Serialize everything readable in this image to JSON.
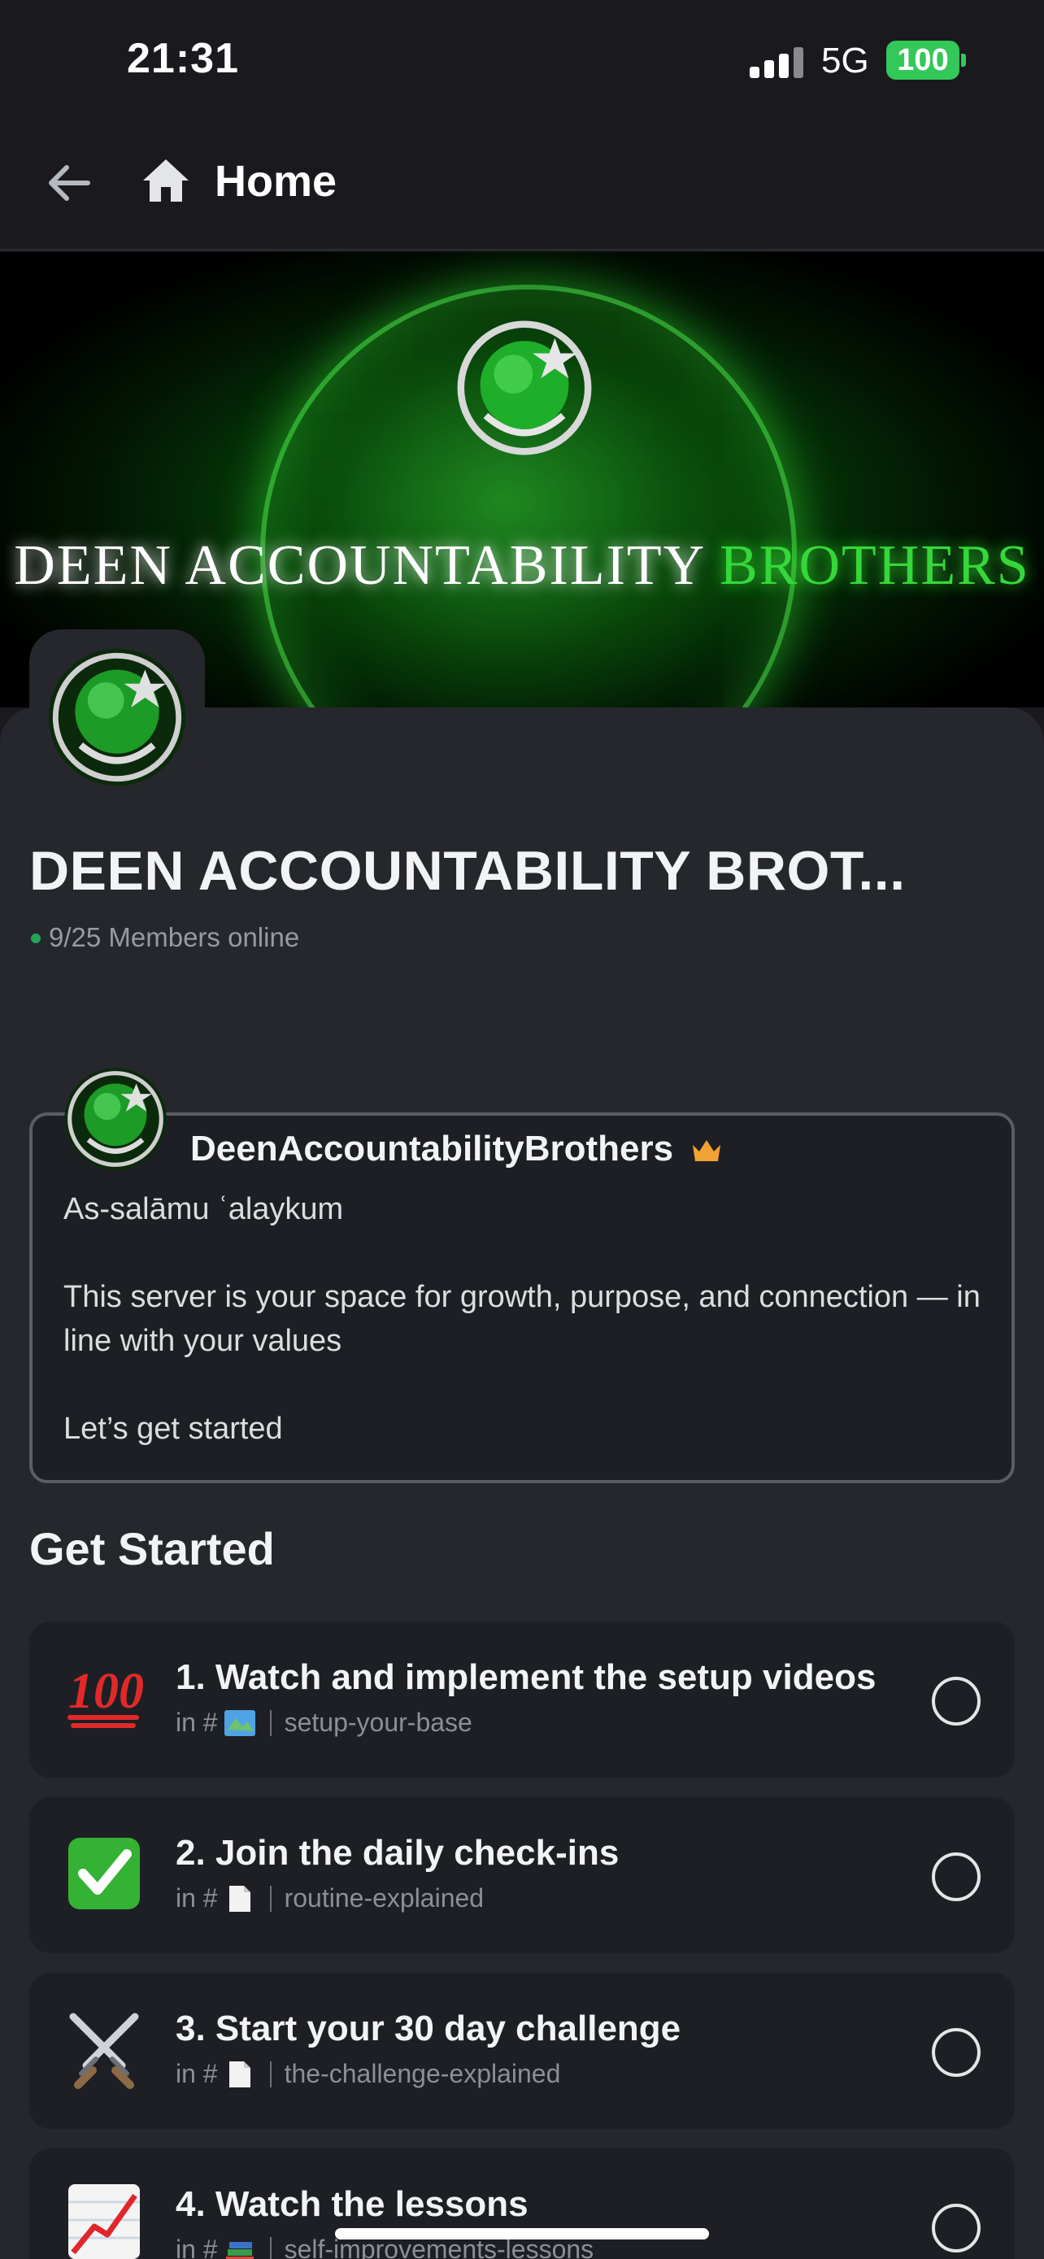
{
  "status_bar": {
    "time": "21:31",
    "network": "5G",
    "battery": "100"
  },
  "header": {
    "back_icon": "arrow-left-icon",
    "home_icon": "home-icon",
    "title": "Home"
  },
  "banner": {
    "text_white": "DEEN ACCOUNTABILITY",
    "text_green": "BROTHERS",
    "accent": "#35d83a"
  },
  "server": {
    "name": "DEEN ACCOUNTABILITY BROT...",
    "online": "9/25 Members online",
    "online_color": "#23a559"
  },
  "welcome": {
    "author": "DeenAccountabilityBrothers",
    "greeting": "As-salāmu ʿalaykum",
    "paragraph": "This server is your space for growth, purpose, and connection — in line with your values",
    "closing": "Let’s get started"
  },
  "get_started": {
    "title": "Get Started",
    "tasks": [
      {
        "title": "1. Watch and implement the setup videos",
        "prefix": "in #",
        "channel": "setup-your-base",
        "emoji": "hundred-points-icon",
        "channel_icon": "map-icon"
      },
      {
        "title": "2. Join the daily check-ins",
        "prefix": "in #",
        "channel": "routine-explained",
        "emoji": "check-mark-icon",
        "channel_icon": "page-icon"
      },
      {
        "title": "3. Start your 30 day challenge",
        "prefix": "in #",
        "channel": "the-challenge-explained",
        "emoji": "crossed-swords-icon",
        "channel_icon": "page-icon"
      },
      {
        "title": "4. Watch the lessons",
        "prefix": "in #",
        "channel": "self-improvements-lessons",
        "emoji": "chart-up-icon",
        "channel_icon": "books-icon"
      }
    ]
  }
}
